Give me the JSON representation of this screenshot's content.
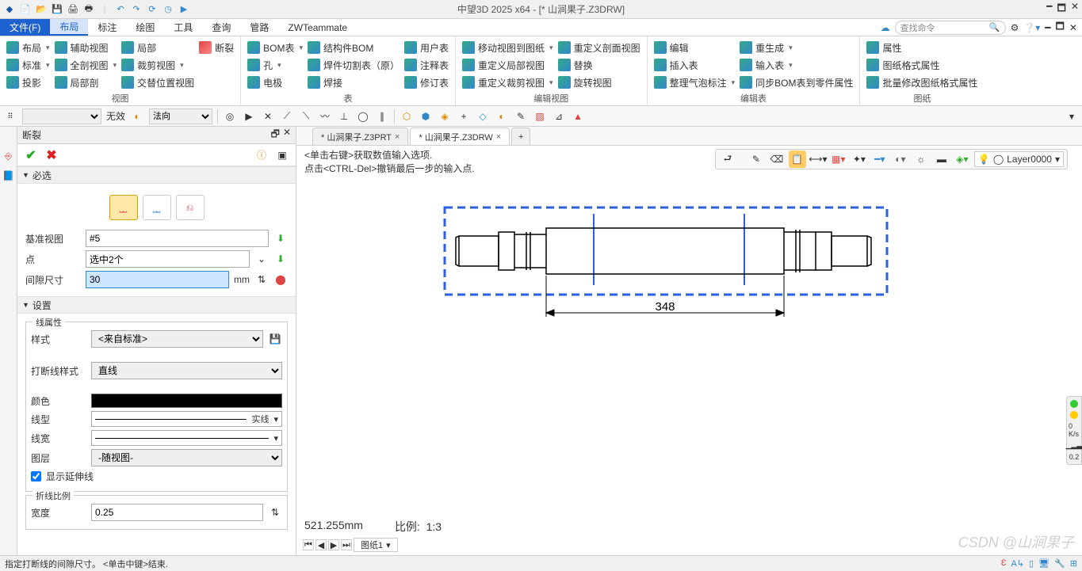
{
  "titlebar": {
    "title": "中望3D 2025 x64 - [* 山涧果子.Z3DRW]"
  },
  "menubar": {
    "tabs": [
      "文件(F)",
      "布局",
      "标注",
      "绘图",
      "工具",
      "查询",
      "管路",
      "ZWTeammate"
    ],
    "search_placeholder": "查找命令"
  },
  "ribbon": {
    "groups": [
      {
        "label": "视图",
        "cols": [
          [
            {
              "t": "布局"
            },
            {
              "t": "标准"
            },
            {
              "t": "投影"
            }
          ],
          [
            {
              "t": "辅助视图"
            },
            {
              "t": "全剖视图"
            },
            {
              "t": "局部剖"
            }
          ],
          [
            {
              "t": "局部"
            },
            {
              "t": "裁剪视图"
            },
            {
              "t": "交替位置视图"
            }
          ],
          [
            {
              "t": "断裂"
            }
          ]
        ]
      },
      {
        "label": "表",
        "cols": [
          [
            {
              "t": "BOM表"
            },
            {
              "t": "孔"
            },
            {
              "t": "电极"
            }
          ],
          [
            {
              "t": "结构件BOM"
            },
            {
              "t": "焊件切割表（原）"
            },
            {
              "t": "焊接"
            }
          ],
          [
            {
              "t": "用户表"
            },
            {
              "t": "注释表"
            },
            {
              "t": "修订表"
            }
          ]
        ]
      },
      {
        "label": "编辑视图",
        "cols": [
          [
            {
              "t": "移动视图到图纸"
            },
            {
              "t": "重定义局部视图"
            },
            {
              "t": "重定义裁剪视图"
            }
          ],
          [
            {
              "t": "重定义剖面视图"
            },
            {
              "t": "替换"
            },
            {
              "t": "旋转视图"
            }
          ]
        ]
      },
      {
        "label": "编辑表",
        "cols": [
          [
            {
              "t": "编辑"
            },
            {
              "t": "插入表"
            },
            {
              "t": "整理气泡标注"
            }
          ],
          [
            {
              "t": "重生成"
            },
            {
              "t": "输入表"
            },
            {
              "t": "同步BOM表到零件属性"
            }
          ]
        ]
      },
      {
        "label": "图纸",
        "cols": [
          [
            {
              "t": "属性"
            },
            {
              "t": "图纸格式属性"
            },
            {
              "t": "批量修改图纸格式属性"
            }
          ]
        ]
      }
    ]
  },
  "toolbar2": {
    "sel1": "无效",
    "sel2": "法向"
  },
  "panel": {
    "tab": "断裂",
    "sections": {
      "required": "必选",
      "settings": "设置",
      "lineattr": "线属性",
      "breakratio": "折线比例"
    },
    "fields": {
      "baseview_label": "基准视图",
      "baseview_value": "#5",
      "point_label": "点",
      "point_value": "选中2个",
      "gap_label": "间隙尺寸",
      "gap_value": "30",
      "gap_unit": "mm",
      "style_label": "样式",
      "style_value": "<来自标准>",
      "breakstyle_label": "打断线样式",
      "breakstyle_value": "直线",
      "color_label": "颜色",
      "linetype_label": "线型",
      "linetype_value": "实线",
      "linewidth_label": "线宽",
      "layer_label": "图层",
      "layer_value": "-随视图-",
      "showext_label": "显示延伸线",
      "width_label": "宽度",
      "width_value": "0.25"
    }
  },
  "doc_tabs": [
    "* 山涧果子.Z3PRT",
    "* 山涧果子.Z3DRW"
  ],
  "canvas": {
    "hint1": "<单击右键>获取数值输入选项.",
    "hint2": "点击<CTRL-Del>撤销最后一步的输入点.",
    "dimension": "348",
    "layer": "Layer0000",
    "status_mm": "521.255mm",
    "status_ratio_label": "比例:",
    "status_ratio": "1:3",
    "sheet_tab": "图纸1"
  },
  "statusbar": {
    "text": "指定打断线的间隙尺寸。 <单击中键>结束."
  },
  "side": {
    "rate": "0 K/s",
    "val": "0.2"
  },
  "watermark": "CSDN @山涧果子"
}
